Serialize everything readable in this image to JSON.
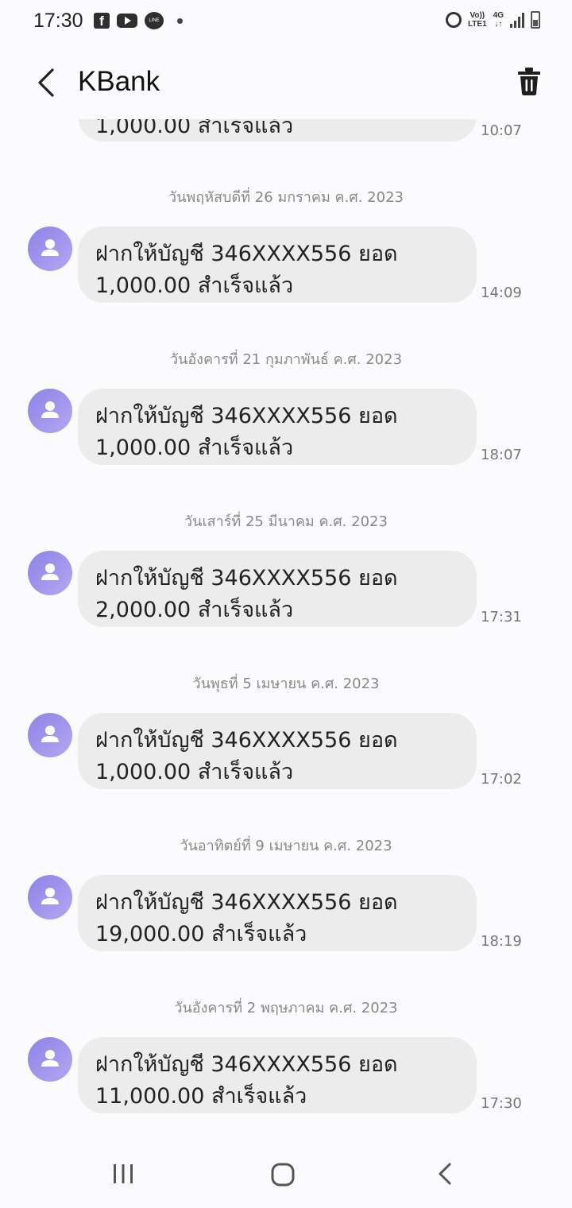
{
  "status_bar": {
    "time": "17:30",
    "fb": "f",
    "line": "LINE",
    "volte": "Vo))\nLTE1",
    "net": "4G"
  },
  "header": {
    "title": "KBank"
  },
  "partial_message": {
    "text": "1,000.00 สำเร็จแล้ว",
    "time": "10:07"
  },
  "messages": [
    {
      "date": "วันพฤหัสบดีที่ 26 มกราคม ค.ศ. 2023",
      "line1": "ฝากให้บัญชี 346XXXX556 ยอด",
      "line2": "1,000.00 สำเร็จแล้ว",
      "time": "14:09"
    },
    {
      "date": "วันอังคารที่ 21 กุมภาพันธ์ ค.ศ. 2023",
      "line1": "ฝากให้บัญชี 346XXXX556 ยอด",
      "line2": "1,000.00 สำเร็จแล้ว",
      "time": "18:07"
    },
    {
      "date": "วันเสาร์ที่ 25 มีนาคม ค.ศ. 2023",
      "line1": "ฝากให้บัญชี 346XXXX556 ยอด",
      "line2": "2,000.00 สำเร็จแล้ว",
      "time": "17:31"
    },
    {
      "date": "วันพุธที่ 5 เมษายน ค.ศ. 2023",
      "line1": "ฝากให้บัญชี 346XXXX556 ยอด",
      "line2": "1,000.00 สำเร็จแล้ว",
      "time": "17:02"
    },
    {
      "date": "วันอาทิตย์ที่ 9 เมษายน ค.ศ. 2023",
      "line1": "ฝากให้บัญชี 346XXXX556 ยอด",
      "line2": "19,000.00 สำเร็จแล้ว",
      "time": "18:19"
    },
    {
      "date": "วันอังคารที่ 2 พฤษภาคม ค.ศ. 2023",
      "line1": "ฝากให้บัญชี 346XXXX556 ยอด",
      "line2": "11,000.00 สำเร็จแล้ว",
      "time": "17:30"
    }
  ],
  "colors": {
    "bubble": "#ececec",
    "avatar": "#9b92ea",
    "background": "#fbfbfd"
  },
  "icons": {
    "back": "chevron-left-icon",
    "delete": "trash-icon",
    "nav_recents": "recents-icon",
    "nav_home": "home-icon",
    "nav_back": "back-icon"
  }
}
